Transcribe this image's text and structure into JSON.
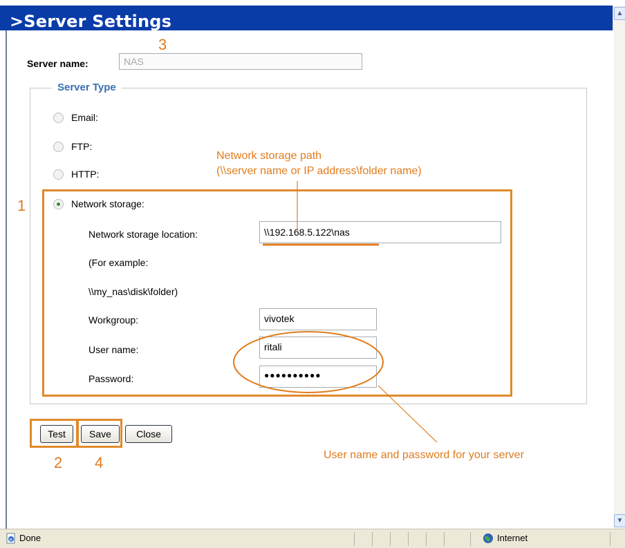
{
  "page": {
    "title": ">Server Settings"
  },
  "server_name": {
    "label": "Server name:",
    "value": "NAS"
  },
  "server_type": {
    "legend": "Server Type",
    "options": [
      {
        "label": "Email:",
        "selected": false
      },
      {
        "label": "FTP:",
        "selected": false
      },
      {
        "label": "HTTP:",
        "selected": false
      },
      {
        "label": "Network storage:",
        "selected": true
      }
    ],
    "network_storage": {
      "location_label": "Network storage location:",
      "location_value": "\\\\192.168.5.122\\nas",
      "example_line1": "(For example:",
      "example_line2": "\\\\my_nas\\disk\\folder)",
      "workgroup_label": "Workgroup:",
      "workgroup_value": "vivotek",
      "username_label": "User name:",
      "username_value": "ritali",
      "password_label": "Password:",
      "password_value": "●●●●●●●●●●"
    }
  },
  "buttons": {
    "test": "Test",
    "save": "Save",
    "close": "Close"
  },
  "annotations": {
    "path_line1": "Network storage path",
    "path_line2": "(\\\\server name or IP address\\folder name)",
    "credentials": "User name and password for your server",
    "num_1": "1",
    "num_2": "2",
    "num_3": "3",
    "num_4": "4",
    "accent_color": "#e07c1e"
  },
  "status_bar": {
    "left": "Done",
    "zone": "Internet"
  },
  "icons": [
    "ie-page-icon",
    "globe-icon",
    "scroll-up-icon",
    "scroll-down-icon"
  ]
}
